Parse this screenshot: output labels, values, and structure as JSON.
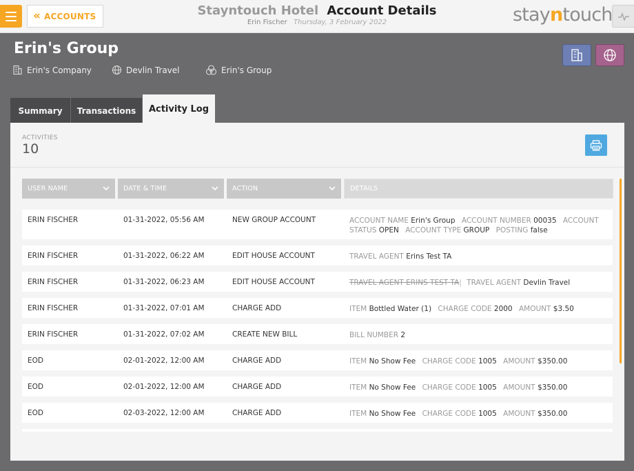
{
  "header": {
    "back_label": "ACCOUNTS",
    "hotel_name": "Stayntouch Hotel",
    "page_title": "Account Details",
    "user_name": "Erin Fischer",
    "date": "Thursday, 3 February 2022",
    "brand_left": "stay",
    "brand_n": "n",
    "brand_right": "touch",
    "accent_color": "#f6a623"
  },
  "group": {
    "name": "Erin's Group",
    "company": "Erin's Company",
    "travel_agent": "Devlin Travel",
    "group_label": "Erin's Group",
    "company_button_icon": "building-icon",
    "agent_button_icon": "globe-icon"
  },
  "tabs": [
    {
      "label": "Summary"
    },
    {
      "label": "Transactions"
    },
    {
      "label": "Activity Log",
      "active": true
    }
  ],
  "activities": {
    "label": "ACTIVITIES",
    "count": "10"
  },
  "table": {
    "columns": [
      "USER NAME",
      "DATE & TIME",
      "ACTION",
      "DETAILS"
    ],
    "rows": [
      {
        "user": "ERIN FISCHER",
        "date": "01-31-2022, 05:56 AM",
        "action": "NEW GROUP ACCOUNT",
        "details": [
          {
            "key": "ACCOUNT NAME",
            "value": "Erin's Group"
          },
          {
            "key": "ACCOUNT NUMBER",
            "value": "00035"
          },
          {
            "key": "ACCOUNT STATUS",
            "value": "OPEN"
          },
          {
            "key": "ACCOUNT TYPE",
            "value": "GROUP"
          },
          {
            "key": "POSTING",
            "value": "false"
          }
        ]
      },
      {
        "user": "ERIN FISCHER",
        "date": "01-31-2022, 06:22 AM",
        "action": "EDIT HOUSE ACCOUNT",
        "details": [
          {
            "key": "TRAVEL AGENT",
            "value": "Erins Test TA"
          }
        ]
      },
      {
        "user": "ERIN FISCHER",
        "date": "01-31-2022, 06:23 AM",
        "action": "EDIT HOUSE ACCOUNT",
        "old": "TRAVEL AGENT ERINS TEST TA",
        "details": [
          {
            "key": "TRAVEL AGENT",
            "value": "Devlin Travel"
          }
        ]
      },
      {
        "user": "ERIN FISCHER",
        "date": "01-31-2022, 07:01 AM",
        "action": "CHARGE ADD",
        "details": [
          {
            "key": "ITEM",
            "value": "Bottled Water (1)"
          },
          {
            "key": "CHARGE CODE",
            "value": "2000"
          },
          {
            "key": "AMOUNT",
            "value": "$3.50"
          }
        ]
      },
      {
        "user": "ERIN FISCHER",
        "date": "01-31-2022, 07:02 AM",
        "action": "CREATE NEW BILL",
        "details": [
          {
            "key": "BILL NUMBER",
            "value": "2"
          }
        ]
      },
      {
        "user": "EOD",
        "date": "02-01-2022, 12:00 AM",
        "action": "CHARGE ADD",
        "details": [
          {
            "key": "ITEM",
            "value": "No Show Fee"
          },
          {
            "key": "CHARGE CODE",
            "value": "1005"
          },
          {
            "key": "AMOUNT",
            "value": "$350.00"
          }
        ]
      },
      {
        "user": "EOD",
        "date": "02-01-2022, 12:00 AM",
        "action": "CHARGE ADD",
        "details": [
          {
            "key": "ITEM",
            "value": "No Show Fee"
          },
          {
            "key": "CHARGE CODE",
            "value": "1005"
          },
          {
            "key": "AMOUNT",
            "value": "$350.00"
          }
        ]
      },
      {
        "user": "EOD",
        "date": "02-03-2022, 12:00 AM",
        "action": "CHARGE ADD",
        "details": [
          {
            "key": "ITEM",
            "value": "No Show Fee"
          },
          {
            "key": "CHARGE CODE",
            "value": "1005"
          },
          {
            "key": "AMOUNT",
            "value": "$350.00"
          }
        ]
      }
    ]
  }
}
